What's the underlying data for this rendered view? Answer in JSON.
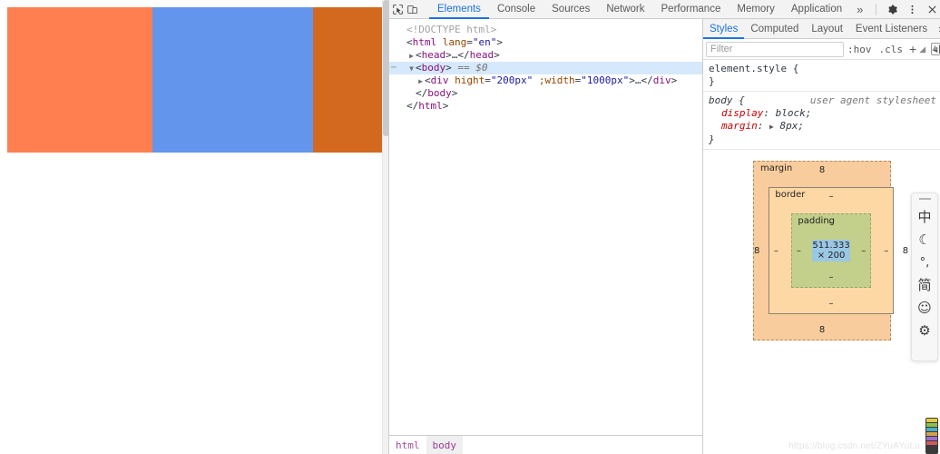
{
  "page": {
    "blocks": [
      {
        "name": "block-coral",
        "color": "#FF7F50"
      },
      {
        "name": "block-blue",
        "color": "#6495ED"
      },
      {
        "name": "block-orange",
        "color": "#D2691E"
      }
    ]
  },
  "devtools": {
    "toolbar": {
      "inspect_icon": "inspect-element-icon",
      "device_icon": "device-toolbar-icon",
      "settings_icon": "gear-icon",
      "menu_icon": "kebab-menu-icon",
      "close_icon": "close-icon",
      "tabs": [
        {
          "label": "Elements",
          "active": true
        },
        {
          "label": "Console",
          "active": false
        },
        {
          "label": "Sources",
          "active": false
        },
        {
          "label": "Network",
          "active": false
        },
        {
          "label": "Performance",
          "active": false
        },
        {
          "label": "Memory",
          "active": false
        },
        {
          "label": "Application",
          "active": false
        }
      ],
      "more_label": "»"
    },
    "dom": {
      "doctype": "<!DOCTYPE html>",
      "rows": [
        {
          "indent": 0,
          "twisty": "",
          "text": "<html lang=\"en\">"
        },
        {
          "indent": 1,
          "twisty": "▶",
          "text": "<head>…</head>"
        },
        {
          "indent": 1,
          "twisty": "▼",
          "text": "<body> == $0"
        },
        {
          "indent": 2,
          "twisty": "▶",
          "text": "<div hight=\"200px\" ;width=\"1000px\">…</div>"
        },
        {
          "indent": 1,
          "twisty": "",
          "text": "</body>"
        },
        {
          "indent": 0,
          "twisty": "",
          "text": "</html>"
        }
      ],
      "selected_tag": "body",
      "selected_marker": "== $0",
      "div_attr1_name": "hight",
      "div_attr1_value": "200px",
      "div_attr2_name": ";width",
      "div_attr2_value": "1000px"
    },
    "breadcrumb": [
      {
        "label": "html",
        "active": false
      },
      {
        "label": "body",
        "active": true
      }
    ],
    "styles": {
      "tabs": [
        {
          "label": "Styles",
          "active": true
        },
        {
          "label": "Computed",
          "active": false
        },
        {
          "label": "Layout",
          "active": false
        },
        {
          "label": "Event Listeners",
          "active": false
        }
      ],
      "more_label": "»",
      "filter_placeholder": "Filter",
      "filter_value": "",
      "hov_label": ":hov",
      "cls_label": ".cls",
      "plus_label": "+",
      "toggle_icon": "new-style-rule-sidebar-icon",
      "rules": [
        {
          "selector": "element.style {",
          "close": "}",
          "source": "",
          "declarations": []
        },
        {
          "selector": "body {",
          "close": "}",
          "source": "user agent stylesheet",
          "declarations": [
            {
              "prop": "display",
              "value": "block;",
              "expandable": false
            },
            {
              "prop": "margin",
              "value": "8px;",
              "expandable": true
            }
          ]
        }
      ],
      "box_model": {
        "margin_label": "margin",
        "border_label": "border",
        "padding_label": "padding",
        "content": "511.333 × 200",
        "margin_top": "8",
        "margin_right": "8",
        "margin_bottom": "8",
        "margin_left": "8",
        "border_top": "–",
        "border_right": "–",
        "border_bottom": "–",
        "border_left": "–",
        "padding_top": "–",
        "padding_right": "–",
        "padding_bottom": "–",
        "padding_left": "–"
      }
    }
  },
  "ime": {
    "items": [
      {
        "glyph": "中",
        "name": "ime-chinese-mode"
      },
      {
        "glyph": "☾",
        "name": "ime-moon-icon"
      },
      {
        "glyph": "°,",
        "name": "ime-punctuation-mode"
      },
      {
        "glyph": "简",
        "name": "ime-simplified-mode"
      },
      {
        "glyph": "☺",
        "name": "ime-emoji-icon"
      },
      {
        "glyph": "⚙",
        "name": "ime-settings-icon"
      }
    ]
  },
  "watermark": {
    "text": "https://blog.csdn.net/ZYuAYuLu"
  }
}
